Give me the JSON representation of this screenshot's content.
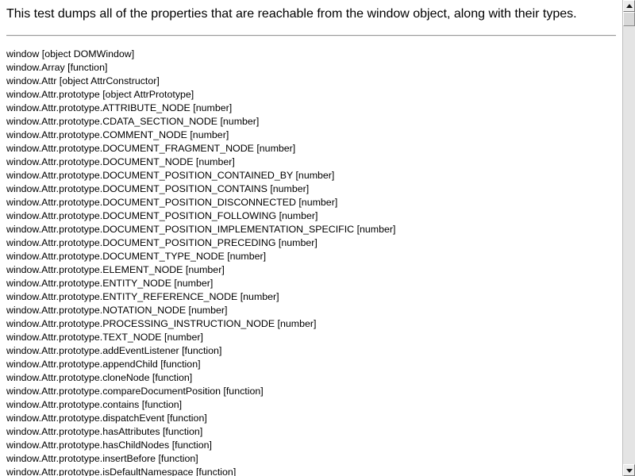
{
  "intro": {
    "text": "This test dumps all of the properties that are reachable from the window object, along with their types."
  },
  "properties": [
    "window [object DOMWindow]",
    "window.Array [function]",
    "window.Attr [object AttrConstructor]",
    "window.Attr.prototype [object AttrPrototype]",
    "window.Attr.prototype.ATTRIBUTE_NODE [number]",
    "window.Attr.prototype.CDATA_SECTION_NODE [number]",
    "window.Attr.prototype.COMMENT_NODE [number]",
    "window.Attr.prototype.DOCUMENT_FRAGMENT_NODE [number]",
    "window.Attr.prototype.DOCUMENT_NODE [number]",
    "window.Attr.prototype.DOCUMENT_POSITION_CONTAINED_BY [number]",
    "window.Attr.prototype.DOCUMENT_POSITION_CONTAINS [number]",
    "window.Attr.prototype.DOCUMENT_POSITION_DISCONNECTED [number]",
    "window.Attr.prototype.DOCUMENT_POSITION_FOLLOWING [number]",
    "window.Attr.prototype.DOCUMENT_POSITION_IMPLEMENTATION_SPECIFIC [number]",
    "window.Attr.prototype.DOCUMENT_POSITION_PRECEDING [number]",
    "window.Attr.prototype.DOCUMENT_TYPE_NODE [number]",
    "window.Attr.prototype.ELEMENT_NODE [number]",
    "window.Attr.prototype.ENTITY_NODE [number]",
    "window.Attr.prototype.ENTITY_REFERENCE_NODE [number]",
    "window.Attr.prototype.NOTATION_NODE [number]",
    "window.Attr.prototype.PROCESSING_INSTRUCTION_NODE [number]",
    "window.Attr.prototype.TEXT_NODE [number]",
    "window.Attr.prototype.addEventListener [function]",
    "window.Attr.prototype.appendChild [function]",
    "window.Attr.prototype.cloneNode [function]",
    "window.Attr.prototype.compareDocumentPosition [function]",
    "window.Attr.prototype.contains [function]",
    "window.Attr.prototype.dispatchEvent [function]",
    "window.Attr.prototype.hasAttributes [function]",
    "window.Attr.prototype.hasChildNodes [function]",
    "window.Attr.prototype.insertBefore [function]",
    "window.Attr.prototype.isDefaultNamespace [function]"
  ],
  "scrollbar": {
    "position_fraction": 0.0
  }
}
